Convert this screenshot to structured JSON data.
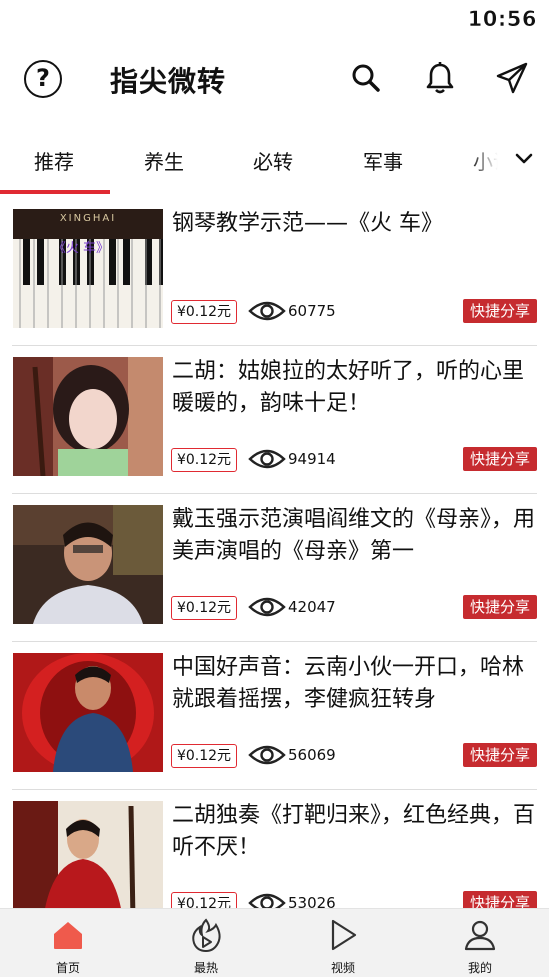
{
  "status_bar": {
    "time": "10:56"
  },
  "header": {
    "title": "指尖微转",
    "help_glyph": "?"
  },
  "tabs": [
    {
      "label": "推荐",
      "active": true
    },
    {
      "label": "养生"
    },
    {
      "label": "必转"
    },
    {
      "label": "军事"
    },
    {
      "label": "小说"
    }
  ],
  "colors": {
    "accent": "#e02a32",
    "share_bg": "#c62b2f"
  },
  "feed": [
    {
      "title": "钢琴教学示范——《火 车》",
      "price": "¥0.12元",
      "views": "60775",
      "share": "快捷分享",
      "thumb_text": "XINGHAI",
      "thumb_caption": "《火 车》"
    },
    {
      "title": "二胡：姑娘拉的太好听了，听的心里暖暖的，韵味十足！",
      "price": "¥0.12元",
      "views": "94914",
      "share": "快捷分享"
    },
    {
      "title": "戴玉强示范演唱阎维文的《母亲》，用美声演唱的《母亲》第一",
      "price": "¥0.12元",
      "views": "42047",
      "share": "快捷分享"
    },
    {
      "title": "中国好声音：云南小伙一开口，哈林就跟着摇摆，李健疯狂转身",
      "price": "¥0.12元",
      "views": "56069",
      "share": "快捷分享"
    },
    {
      "title": "二胡独奏《打靶归来》，红色经典，百听不厌！",
      "price": "¥0.12元",
      "views": "53026",
      "share": "快捷分享"
    }
  ],
  "bottom_nav": [
    {
      "label": "首页",
      "icon": "home-icon",
      "active": true
    },
    {
      "label": "最热",
      "icon": "hot-icon"
    },
    {
      "label": "视频",
      "icon": "play-icon"
    },
    {
      "label": "我的",
      "icon": "user-icon"
    }
  ]
}
